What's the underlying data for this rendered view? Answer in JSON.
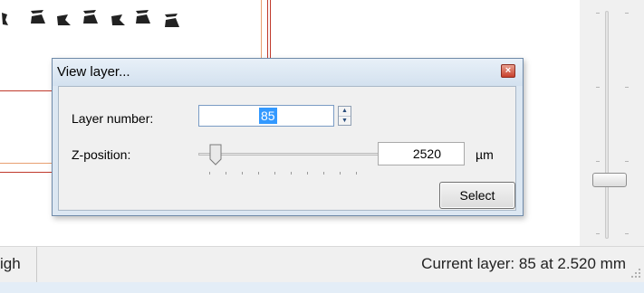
{
  "dialog": {
    "title": "View layer...",
    "close_glyph": "×",
    "layer_number_label": "Layer number:",
    "layer_number_value": "85",
    "z_position_label": "Z-position:",
    "z_position_value": "2520",
    "unit": "µm",
    "select_label": "Select",
    "spin_up_glyph": "▲",
    "spin_down_glyph": "▼"
  },
  "statusbar": {
    "left_text": "igh",
    "current_layer_text": "Current layer: 85 at 2.520 mm"
  },
  "colors": {
    "line_red": "#c0392b",
    "line_orange": "#e8a070",
    "selection": "#3399ff"
  },
  "icons": {
    "close": "close-icon",
    "spin_up": "arrow-up-icon",
    "spin_down": "arrow-down-icon",
    "size_grip": "resize-grip-icon"
  }
}
